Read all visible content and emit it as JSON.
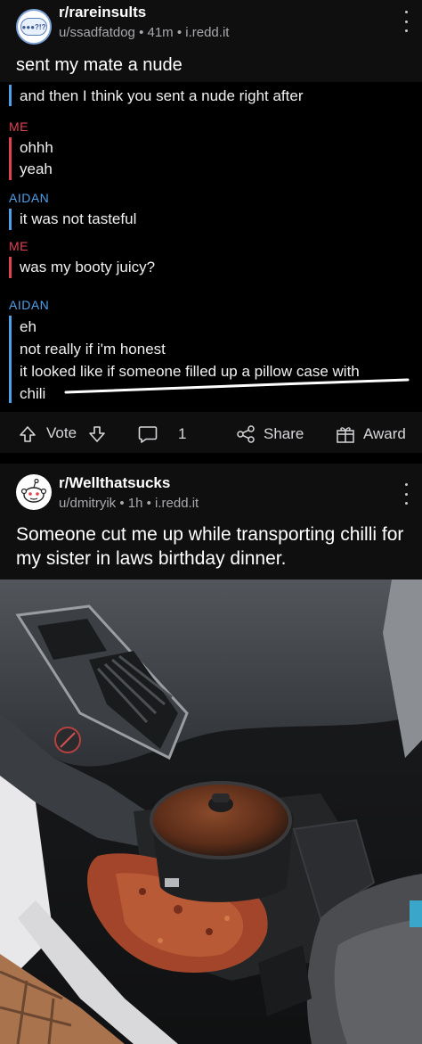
{
  "post1": {
    "avatar_text": "●●●?!?",
    "subreddit": "r/rareinsults",
    "meta": "u/ssadfatdog • 41m • i.redd.it",
    "title": "sent my mate a nude",
    "chat": {
      "line0": "and then I think you sent a nude right after",
      "me_label_1": "ME",
      "me_line_1a": "ohhh",
      "me_line_1b": "yeah",
      "aidan_label_1": "AIDAN",
      "aidan_line_1": "it was not tasteful",
      "me_label_2": "ME",
      "me_line_2": "was my booty juicy?",
      "aidan_label_2": "AIDAN",
      "aidan_line_2a": "eh",
      "aidan_line_2b": "not really if i'm honest",
      "aidan_line_2c": "it looked like if someone filled up a pillow case with",
      "aidan_line_2d": "chili"
    },
    "actions": {
      "vote": "Vote",
      "comments": "1",
      "share": "Share",
      "award": "Award"
    }
  },
  "post2": {
    "subreddit": "r/Wellthatsucks",
    "meta": "u/dmitryik • 1h • i.redd.it",
    "title": "Someone cut me up while transporting chilli for my sister in laws birthday dinner."
  },
  "colors": {
    "me": "#e0424f",
    "aidan": "#4ea0e8",
    "background": "#0f0f10"
  }
}
